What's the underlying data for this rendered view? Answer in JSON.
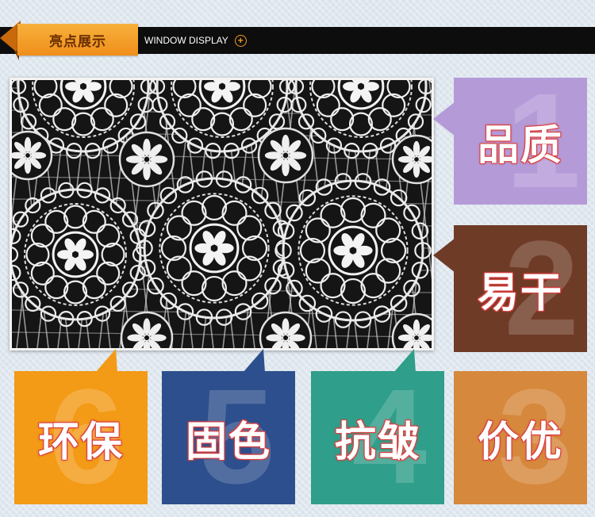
{
  "header": {
    "title": "亮点展示",
    "subtitle": "WINDOW DISPLAY",
    "plus_icon": "plus-circle-icon",
    "accent_color": "#f39a22"
  },
  "photo": {
    "subject": "white guipure lace fabric on black background",
    "icon": "lace-photo"
  },
  "features": [
    {
      "digit": "1",
      "label": "品质",
      "color": "#b59ad8"
    },
    {
      "digit": "2",
      "label": "易干",
      "color": "#6e3b26"
    },
    {
      "digit": "3",
      "label": "价优",
      "color": "#d6883c"
    },
    {
      "digit": "4",
      "label": "抗皱",
      "color": "#2f9e8a"
    },
    {
      "digit": "5",
      "label": "固色",
      "color": "#2d4f8d"
    },
    {
      "digit": "6",
      "label": "环保",
      "color": "#f39a16"
    }
  ]
}
